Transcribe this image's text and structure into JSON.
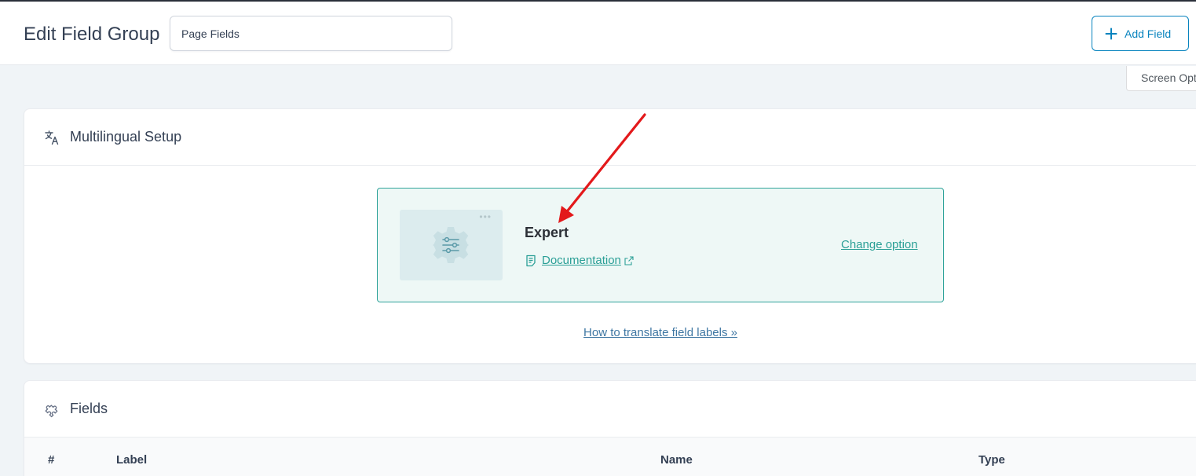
{
  "header": {
    "title": "Edit Field Group",
    "title_input_value": "Page Fields",
    "add_field_label": "Add Field"
  },
  "screen_options": {
    "label": "Screen Opt"
  },
  "multilingual": {
    "heading": "Multilingual Setup",
    "option": {
      "name": "Expert",
      "doc_label": "Documentation",
      "change_label": "Change option"
    },
    "translate_link": "How to translate field labels »"
  },
  "fields": {
    "heading": "Fields",
    "columns": [
      "#",
      "Label",
      "Name",
      "Type"
    ]
  },
  "colors": {
    "accent": "#0783be",
    "teal": "#2a9f96",
    "annotation_arrow": "#e3191b"
  },
  "icons": {
    "plus": "plus-icon",
    "translate": "translate-icon",
    "settings": "sliders-gear-icon",
    "doc": "document-icon",
    "external": "external-link-icon",
    "puzzle": "puzzle-icon"
  }
}
